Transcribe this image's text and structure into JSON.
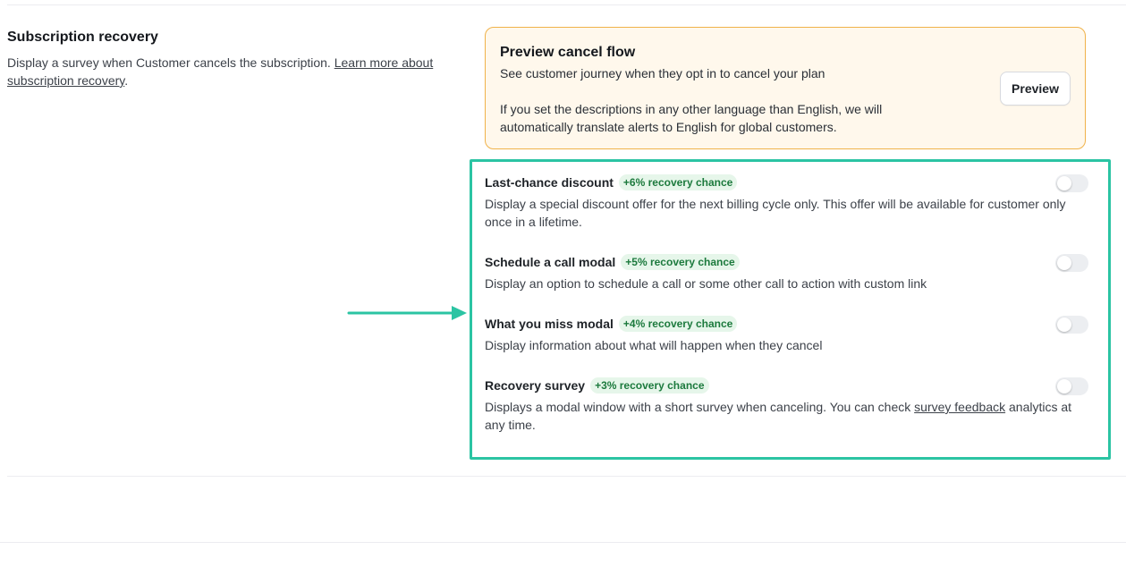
{
  "section": {
    "title": "Subscription recovery",
    "desc_text": "Display a survey when Customer cancels the subscription. ",
    "learn_more_link": "Learn more about subscription recovery",
    "desc_end": "."
  },
  "preview_card": {
    "title": "Preview cancel flow",
    "line1": "See customer journey when they opt in to cancel your plan",
    "line2": "If you set the descriptions in any other language than English, we will",
    "line3": "automatically translate alerts to English for global customers.",
    "button_label": "Preview"
  },
  "options": [
    {
      "title": "Last-chance discount",
      "badge": "+6% recovery chance",
      "desc": "Display a special discount offer for the next billing cycle only. This offer will be available for customer only once in a lifetime.",
      "enabled": false
    },
    {
      "title": "Schedule a call modal",
      "badge": "+5% recovery chance",
      "desc": "Display an option to schedule a call or some other call to action with custom link",
      "enabled": false
    },
    {
      "title": "What you miss modal",
      "badge": "+4% recovery chance",
      "desc": "Display information about what will happen when they cancel",
      "enabled": false
    },
    {
      "title": "Recovery survey",
      "badge": "+3% recovery chance",
      "desc_before": "Displays a modal window with a short survey when canceling. You can check ",
      "desc_link": "survey feedback",
      "desc_after": " analytics at any time.",
      "enabled": false
    }
  ],
  "colors": {
    "highlight": "#2bc4a3",
    "card_bg": "#fff8ec",
    "card_border": "#f0b24a",
    "badge_bg": "#e6f6ea",
    "badge_text": "#1c7a3d"
  },
  "icons": {
    "arrow": "arrow-right-icon"
  }
}
